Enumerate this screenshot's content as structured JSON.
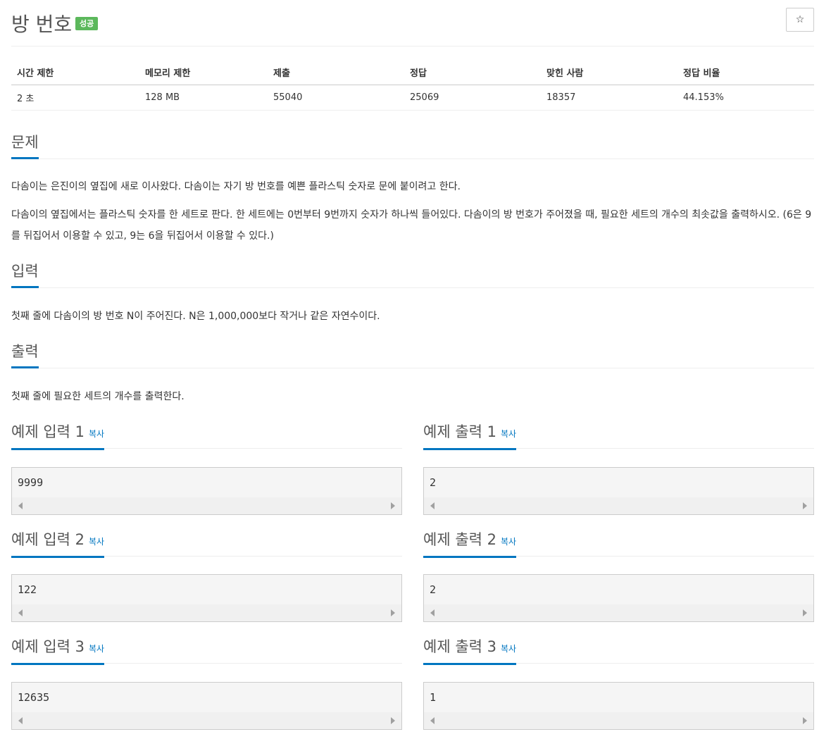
{
  "problem": {
    "title": "방 번호",
    "badge": "성공",
    "star_icon": "☆"
  },
  "info_table": {
    "headers": [
      "시간 제한",
      "메모리 제한",
      "제출",
      "정답",
      "맞힌 사람",
      "정답 비율"
    ],
    "values": [
      "2 초",
      "128 MB",
      "55040",
      "25069",
      "18357",
      "44.153%"
    ]
  },
  "sections": {
    "description": {
      "title": "문제",
      "paragraphs": [
        "다솜이는 은진이의 옆집에 새로 이사왔다. 다솜이는 자기 방 번호를 예쁜 플라스틱 숫자로 문에 붙이려고 한다.",
        "다솜이의 옆집에서는 플라스틱 숫자를 한 세트로 판다. 한 세트에는 0번부터 9번까지 숫자가 하나씩 들어있다. 다솜이의 방 번호가 주어졌을 때, 필요한 세트의 개수의 최솟값을 출력하시오. (6은 9를 뒤집어서 이용할 수 있고, 9는 6을 뒤집어서 이용할 수 있다.)"
      ]
    },
    "input": {
      "title": "입력",
      "text": "첫째 줄에 다솜이의 방 번호 N이 주어진다. N은 1,000,000보다 작거나 같은 자연수이다."
    },
    "output": {
      "title": "출력",
      "text": "첫째 줄에 필요한 세트의 개수를 출력한다."
    }
  },
  "copy_label": "복사",
  "examples": [
    {
      "input_title": "예제 입력 1",
      "input": "9999",
      "output_title": "예제 출력 1",
      "output": "2"
    },
    {
      "input_title": "예제 입력 2",
      "input": "122",
      "output_title": "예제 출력 2",
      "output": "2"
    },
    {
      "input_title": "예제 입력 3",
      "input": "12635",
      "output_title": "예제 출력 3",
      "output": "1"
    }
  ]
}
